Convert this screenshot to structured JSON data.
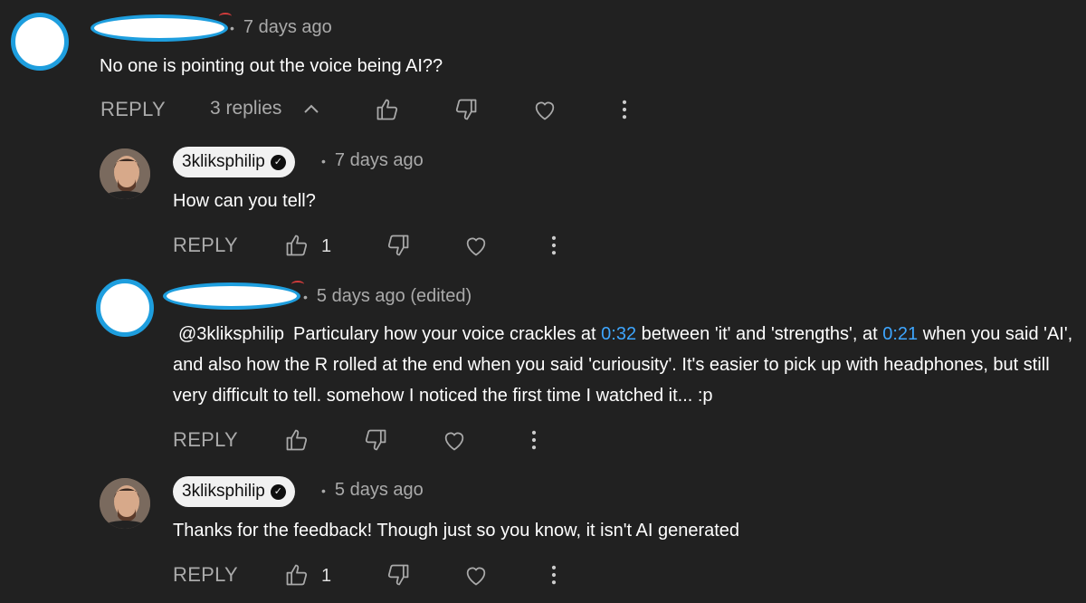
{
  "comments": [
    {
      "author": "",
      "time": "7 days ago",
      "text": "No one is pointing out the voice being AI??",
      "reply_label": "REPLY",
      "replies_label": "3 replies",
      "likes": ""
    },
    {
      "author": "3kliksphilip",
      "time": "7 days ago",
      "text": "How can you tell?",
      "reply_label": "REPLY",
      "likes": "1"
    },
    {
      "author": "",
      "time": "5 days ago (edited)",
      "mention": "@3kliksphilip",
      "text_parts": {
        "p1": "Particulary how your voice crackles at",
        "ts1": "0:32",
        "p2": "between 'it' and 'strengths', at",
        "ts2": "0:21",
        "p3": "when you said 'AI', and also how the R rolled at the end when you said 'curiousity'. It's easier to pick up with headphones, but still very difficult to tell. somehow I noticed the first time I watched it... :p"
      },
      "reply_label": "REPLY",
      "likes": ""
    },
    {
      "author": "3kliksphilip",
      "time": "5 days ago",
      "text": "Thanks for the feedback! Though just so you know, it isn't AI generated",
      "reply_label": "REPLY",
      "likes": "1"
    }
  ],
  "icons": {
    "like": "thumbs-up-icon",
    "dislike": "thumbs-down-icon",
    "heart": "heart-icon",
    "more": "more-vert-icon",
    "chevron": "chevron-up-icon",
    "verified": "verified-check-icon"
  },
  "colors": {
    "background": "#212121",
    "secondary_text": "#aaaaaa",
    "timestamp_link": "#3ea6ff",
    "redaction_border": "#1e9ede"
  },
  "dot": "•"
}
